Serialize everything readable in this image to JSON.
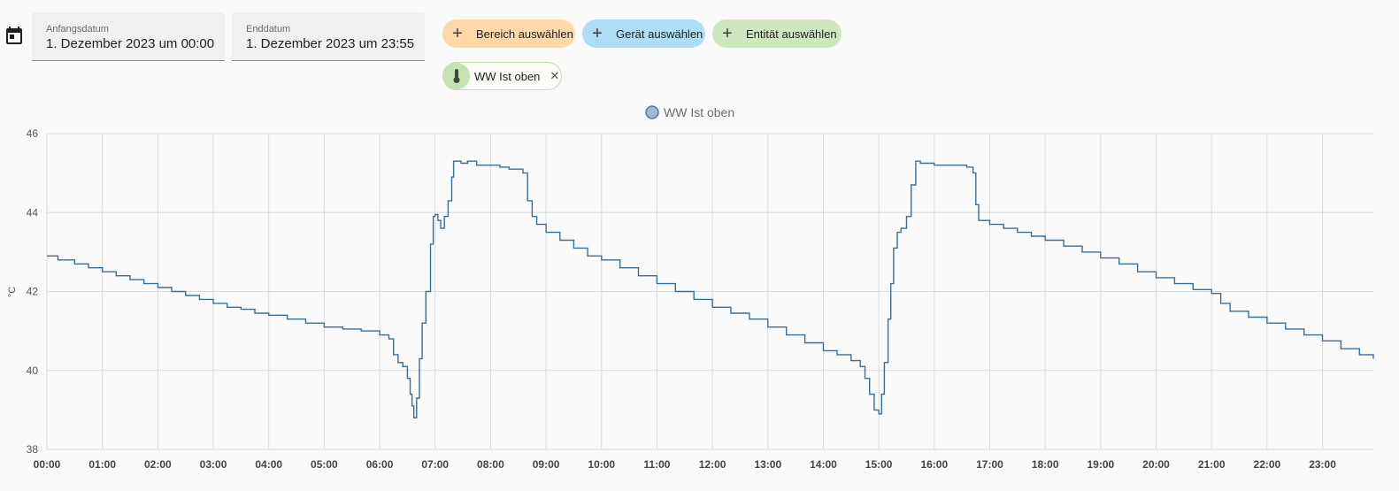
{
  "picker": {
    "start_label": "Anfangsdatum",
    "start_value": "1. Dezember 2023 um 00:00",
    "end_label": "Enddatum",
    "end_value": "1. Dezember 2023 um 23:55",
    "calendar_icon": "calendar-icon"
  },
  "targets": {
    "area_label": "Bereich auswählen",
    "device_label": "Gerät auswählen",
    "entity_label": "Entität auswählen",
    "plus_icon": "plus-icon"
  },
  "selected_entity": {
    "name": "WW Ist oben",
    "icon": "thermometer-icon",
    "remove_icon": "close-icon"
  },
  "colors": {
    "area_chip": "#fdd9a8",
    "device_chip": "#aeddf6",
    "entity_chip": "#cfe7bf",
    "series": "#3b6e99",
    "legend_marker": "#a4b7cc"
  },
  "chart_data": {
    "type": "line",
    "step": true,
    "ylabel": "°C",
    "ylim": [
      38,
      46
    ],
    "yticks": [
      38,
      40,
      42,
      44,
      46
    ],
    "xlim": [
      "00:00",
      "23:55"
    ],
    "xticks": [
      "00:00",
      "01:00",
      "02:00",
      "03:00",
      "04:00",
      "05:00",
      "06:00",
      "07:00",
      "08:00",
      "09:00",
      "10:00",
      "11:00",
      "12:00",
      "13:00",
      "14:00",
      "15:00",
      "16:00",
      "17:00",
      "18:00",
      "19:00",
      "20:00",
      "21:00",
      "22:00",
      "23:00"
    ],
    "grid": true,
    "legend_position": "top-center",
    "series": [
      {
        "name": "WW Ist oben",
        "x": [
          "00:00",
          "00:12",
          "00:30",
          "00:45",
          "01:00",
          "01:15",
          "01:30",
          "01:45",
          "02:00",
          "02:15",
          "02:30",
          "02:45",
          "03:00",
          "03:15",
          "03:30",
          "03:45",
          "04:00",
          "04:20",
          "04:40",
          "05:00",
          "05:20",
          "05:40",
          "06:00",
          "06:10",
          "06:15",
          "06:20",
          "06:25",
          "06:30",
          "06:33",
          "06:35",
          "06:37",
          "06:40",
          "06:43",
          "06:46",
          "06:50",
          "06:55",
          "06:58",
          "07:00",
          "07:03",
          "07:06",
          "07:10",
          "07:14",
          "07:18",
          "07:20",
          "07:22",
          "07:28",
          "07:35",
          "07:45",
          "08:00",
          "08:10",
          "08:20",
          "08:35",
          "08:40",
          "08:45",
          "08:50",
          "09:00",
          "09:15",
          "09:30",
          "09:45",
          "10:00",
          "10:20",
          "10:40",
          "11:00",
          "11:20",
          "11:40",
          "12:00",
          "12:20",
          "12:40",
          "13:00",
          "13:20",
          "13:40",
          "14:00",
          "14:15",
          "14:30",
          "14:40",
          "14:45",
          "14:50",
          "14:55",
          "15:00",
          "15:03",
          "15:06",
          "15:10",
          "15:13",
          "15:16",
          "15:20",
          "15:24",
          "15:30",
          "15:35",
          "15:40",
          "15:45",
          "16:00",
          "16:20",
          "16:35",
          "16:42",
          "16:45",
          "16:48",
          "17:00",
          "17:15",
          "17:30",
          "17:45",
          "18:00",
          "18:20",
          "18:40",
          "19:00",
          "19:20",
          "19:40",
          "20:00",
          "20:20",
          "20:40",
          "21:00",
          "21:10",
          "21:20",
          "21:40",
          "22:00",
          "22:20",
          "22:40",
          "23:00",
          "23:20",
          "23:40",
          "23:55"
        ],
        "values": [
          42.9,
          42.8,
          42.7,
          42.6,
          42.5,
          42.4,
          42.3,
          42.2,
          42.1,
          42.0,
          41.9,
          41.8,
          41.7,
          41.6,
          41.55,
          41.45,
          41.4,
          41.3,
          41.2,
          41.1,
          41.05,
          41.0,
          40.9,
          40.8,
          40.4,
          40.2,
          40.1,
          39.8,
          39.4,
          39.1,
          38.8,
          39.3,
          40.3,
          41.2,
          42.0,
          43.2,
          43.9,
          43.95,
          43.8,
          43.6,
          43.9,
          44.3,
          44.9,
          45.3,
          45.3,
          45.25,
          45.3,
          45.2,
          45.2,
          45.15,
          45.1,
          45.0,
          44.3,
          43.9,
          43.7,
          43.5,
          43.3,
          43.1,
          42.9,
          42.8,
          42.6,
          42.4,
          42.2,
          42.0,
          41.8,
          41.6,
          41.45,
          41.3,
          41.1,
          40.9,
          40.7,
          40.5,
          40.4,
          40.25,
          40.1,
          39.8,
          39.4,
          39.0,
          38.9,
          39.4,
          40.2,
          41.3,
          42.2,
          43.1,
          43.5,
          43.6,
          43.9,
          44.7,
          45.3,
          45.25,
          45.2,
          45.2,
          45.15,
          45.0,
          44.2,
          43.8,
          43.7,
          43.6,
          43.5,
          43.4,
          43.3,
          43.15,
          43.0,
          42.85,
          42.7,
          42.5,
          42.35,
          42.2,
          42.05,
          41.95,
          41.7,
          41.5,
          41.35,
          41.2,
          41.05,
          40.9,
          40.75,
          40.55,
          40.4,
          40.3
        ]
      }
    ]
  }
}
